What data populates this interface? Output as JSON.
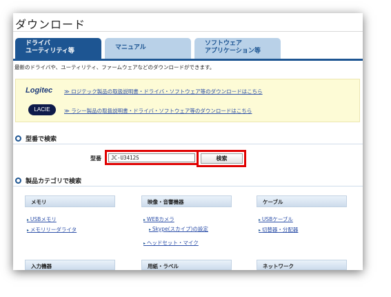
{
  "page": {
    "title": "ダウンロード",
    "description": "最新のドライバや、ユーティリティ、ファームウェアなどのダウンロードができます。"
  },
  "tabs": [
    {
      "label_line1": "ドライバ",
      "label_line2": "ユーティリティ等",
      "active": true
    },
    {
      "label_line1": "マニュアル",
      "label_line2": "",
      "active": false
    },
    {
      "label_line1": "ソフトウェア",
      "label_line2": "アプリケーション等",
      "active": false
    }
  ],
  "notice": {
    "logitec_logo": "Logitec",
    "logitec_link": "≫ ロジテック製品の取扱説明書・ドライバ・ソフトウェア等のダウンロードはこちら",
    "lacie_logo": "LACIE",
    "lacie_link": "≫ ラシー製品の取扱説明書・ドライバ・ソフトウェア等のダウンロードはこちら"
  },
  "model_search": {
    "heading": "型番で検索",
    "label": "型番",
    "value": "JC-U3412S",
    "button": "検索"
  },
  "category_search": {
    "heading": "製品カテゴリで検索",
    "categories": [
      {
        "name": "メモリ",
        "items": [
          "USBメモリ",
          "メモリリーダライタ"
        ]
      },
      {
        "name": "映像・音響機器",
        "items": [
          "WEBカメラ",
          "Skype(スカイプ)の設定",
          "ヘッドセット・マイク"
        ]
      },
      {
        "name": "ケーブル",
        "items": [
          "USBケーブル",
          "切替器・分配器"
        ]
      }
    ],
    "more_categories": [
      "入力機器",
      "用紙・ラベル",
      "ネットワーク"
    ]
  },
  "colors": {
    "accent": "#1d5592",
    "tab_inactive": "#b9d1e8",
    "link": "#2c4fa8",
    "highlight": "#e00000",
    "notice_bg": "#fdfbd6"
  }
}
